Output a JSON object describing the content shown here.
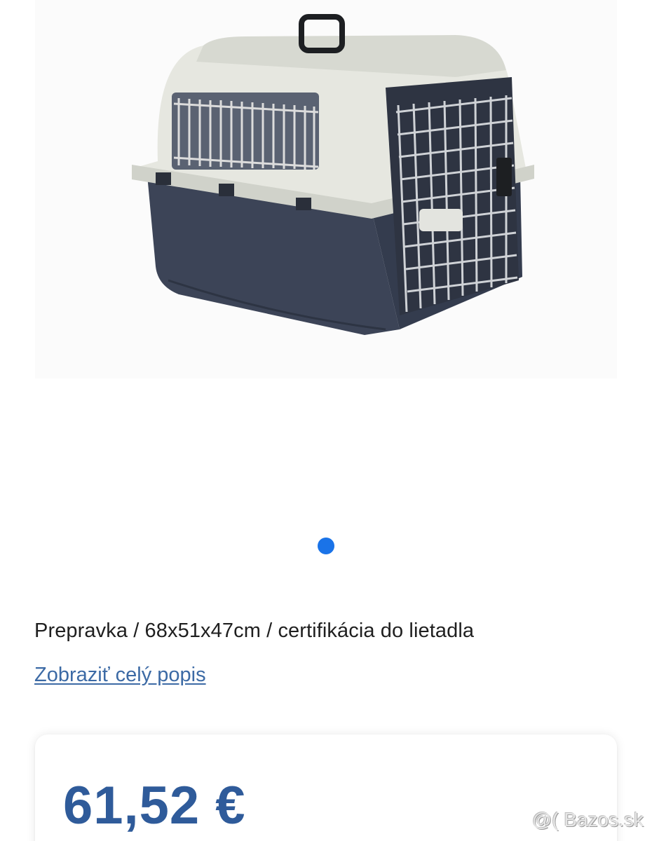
{
  "listing": {
    "title": "Prepravka / 68x51x47cm / certifikácia do lietadla",
    "description_link": "Zobraziť celý popis",
    "price": "61,52 €",
    "image": {
      "subject": "pet-carrier",
      "pages": 1,
      "current_page": 1
    }
  },
  "watermark": "@( Bazos.sk",
  "colors": {
    "accent": "#1a73e8",
    "link": "#3c6aa5",
    "price": "#2f5b9a",
    "text": "#1f1f1f",
    "carrier_top": "#e6e7e0",
    "carrier_bottom": "#3c4457"
  }
}
